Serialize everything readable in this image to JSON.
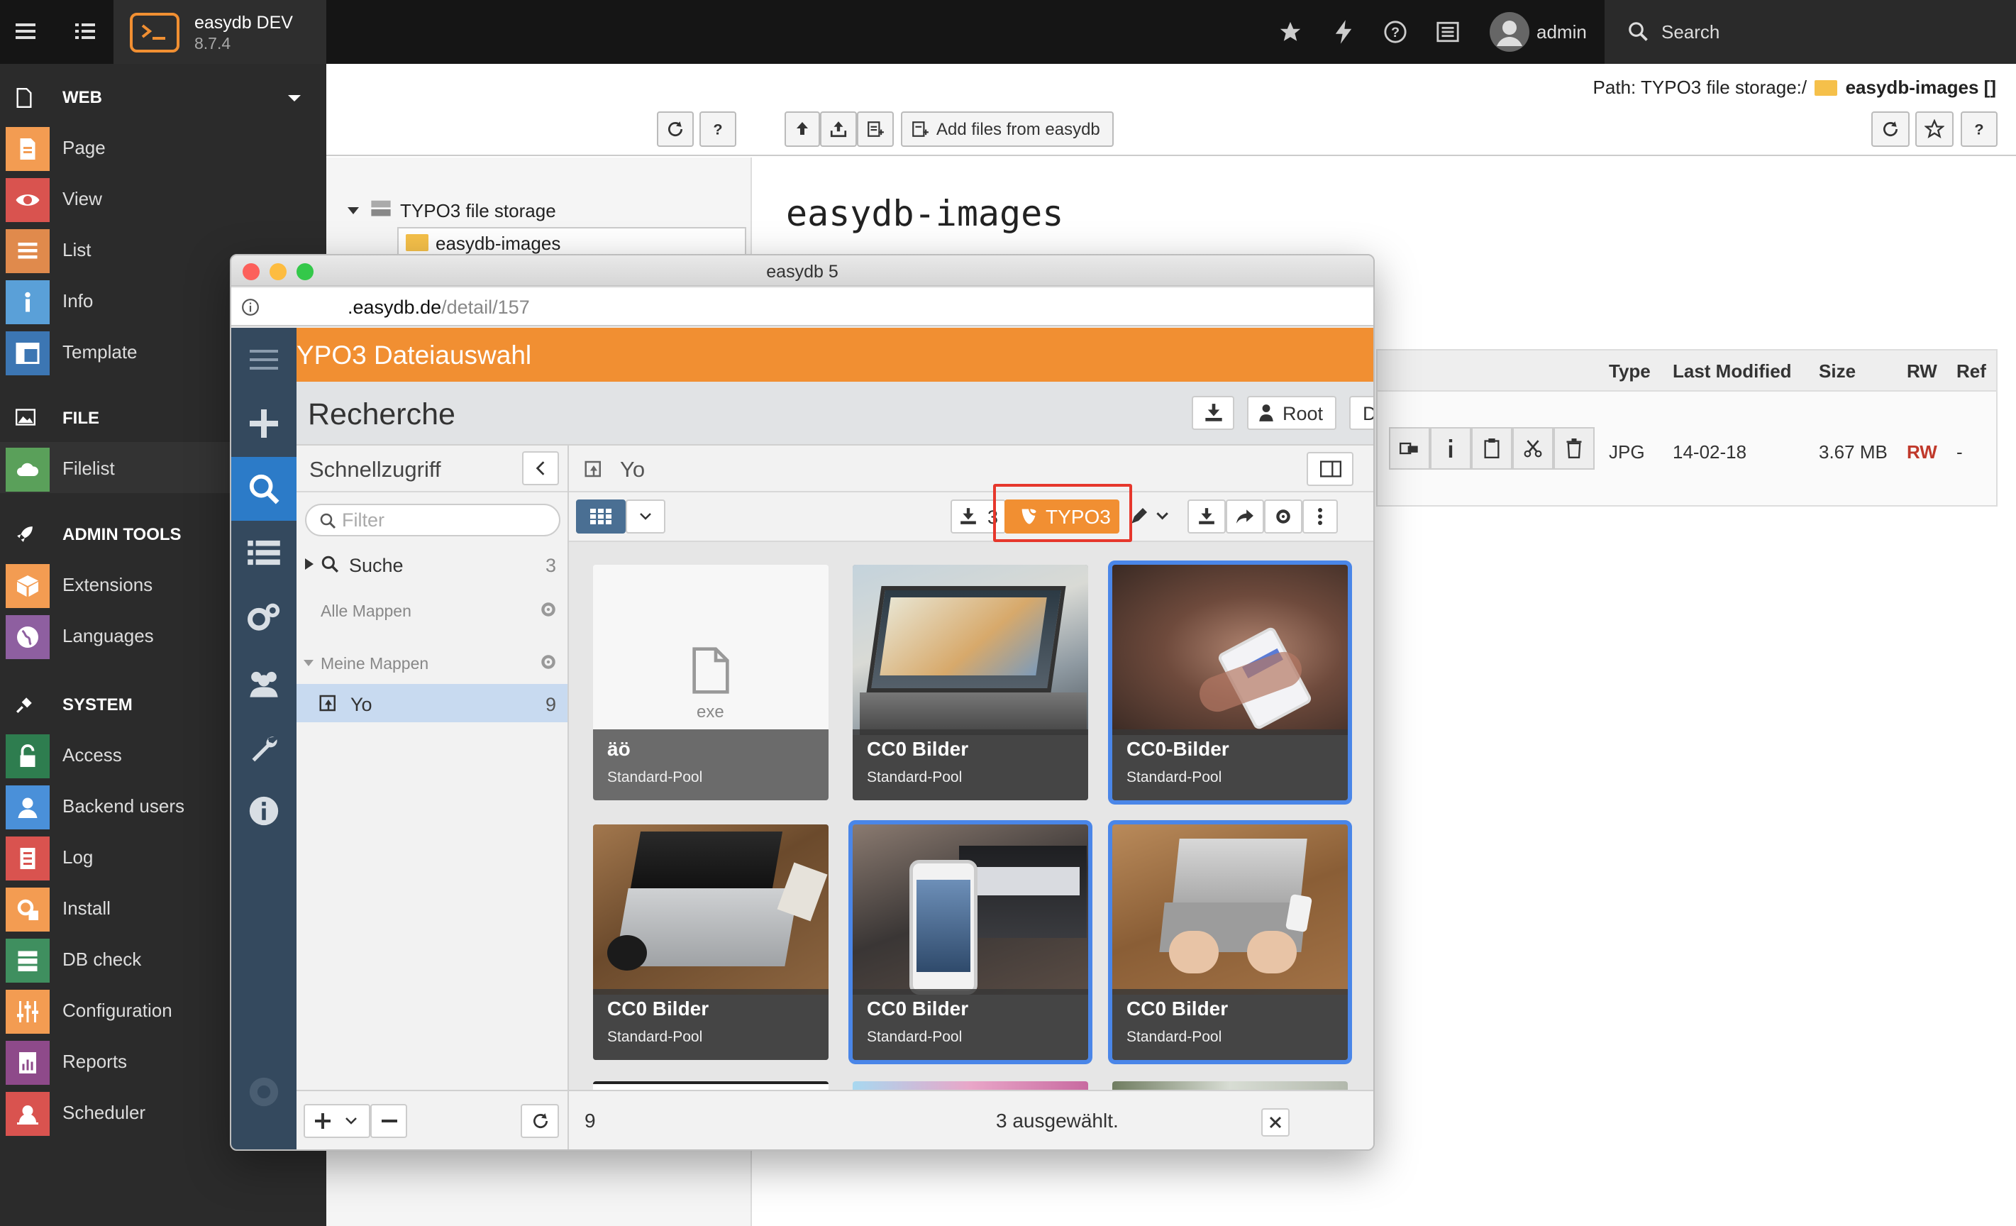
{
  "topbar": {
    "app_name": "easydb DEV",
    "app_version": "8.7.4",
    "user": "admin",
    "search_label": "Search",
    "icons": [
      "menu-icon",
      "list-icon",
      "terminal-logo",
      "star-icon",
      "flash-icon",
      "help-icon",
      "news-icon",
      "user-icon",
      "search-icon"
    ]
  },
  "module_menu": {
    "groups": [
      {
        "label": "WEB",
        "icon": "file-icon"
      },
      {
        "label": "FILE",
        "icon": "image-icon"
      },
      {
        "label": "ADMIN TOOLS",
        "icon": "rocket-icon"
      },
      {
        "label": "SYSTEM",
        "icon": "plug-icon"
      }
    ],
    "items": [
      {
        "label": "Page",
        "color": "#f39c52"
      },
      {
        "label": "View",
        "color": "#d9534f"
      },
      {
        "label": "List",
        "color": "#e08a4c"
      },
      {
        "label": "Info",
        "color": "#5aa0d8"
      },
      {
        "label": "Template",
        "color": "#3c76b3"
      },
      {
        "label": "Filelist",
        "color": "#5aa05a"
      },
      {
        "label": "Extensions",
        "color": "#f39c52"
      },
      {
        "label": "Languages",
        "color": "#8e5fa0"
      },
      {
        "label": "Access",
        "color": "#2e7d4f"
      },
      {
        "label": "Backend users",
        "color": "#4a90d9"
      },
      {
        "label": "Log",
        "color": "#d9534f"
      },
      {
        "label": "Install",
        "color": "#f39c52"
      },
      {
        "label": "DB check",
        "color": "#3f8f5f"
      },
      {
        "label": "Configuration",
        "color": "#f39c52"
      },
      {
        "label": "Reports",
        "color": "#8e4a8a"
      },
      {
        "label": "Scheduler",
        "color": "#d9534f"
      }
    ]
  },
  "content": {
    "path_prefix": "Path: TYPO3 file storage:/",
    "path_folder": "easydb-images []",
    "add_files_label": "Add files from easydb",
    "tree_root": "TYPO3 file storage",
    "tree_child": "easydb-images",
    "folder_title": "easydb-images",
    "table": {
      "headers": [
        "Type",
        "Last Modified",
        "Size",
        "RW",
        "Ref"
      ],
      "row": {
        "type": "JPG",
        "modified": "14-02-18",
        "size": "3.67 MB",
        "rw": "RW",
        "ref": "-"
      }
    }
  },
  "popup": {
    "window_title": "easydb 5",
    "url_host": ".easydb.de",
    "url_path": "/detail/157",
    "header": "YPO3 Dateiauswahl",
    "section_title": "Recherche",
    "buttons": {
      "root": "Root",
      "lang": "DE"
    },
    "quick_access": {
      "title": "Schnellzugriff",
      "filter_placeholder": "Filter",
      "search_label": "Suche",
      "search_count": "3",
      "all_collections": "Alle Mappen",
      "my_collections": "Meine Mappen",
      "collection_name": "Yo",
      "collection_count": "9"
    },
    "main": {
      "collection_title": "Yo",
      "download_count": "3",
      "typo3_label": "TYPO3",
      "cards": [
        {
          "title": "äö",
          "subtitle": "Standard-Pool",
          "kind": "file",
          "ext": "exe",
          "selected": false
        },
        {
          "title": "CC0 Bilder",
          "subtitle": "Standard-Pool",
          "kind": "photo",
          "selected": false
        },
        {
          "title": "CC0-Bilder",
          "subtitle": "Standard-Pool",
          "kind": "photo",
          "selected": true
        },
        {
          "title": "CC0 Bilder",
          "subtitle": "Standard-Pool",
          "kind": "photo",
          "selected": false
        },
        {
          "title": "CC0 Bilder",
          "subtitle": "Standard-Pool",
          "kind": "photo",
          "selected": true
        },
        {
          "title": "CC0 Bilder",
          "subtitle": "Standard-Pool",
          "kind": "photo",
          "selected": true
        }
      ],
      "footer_count": "9",
      "footer_selected": "3 ausgewählt."
    }
  }
}
